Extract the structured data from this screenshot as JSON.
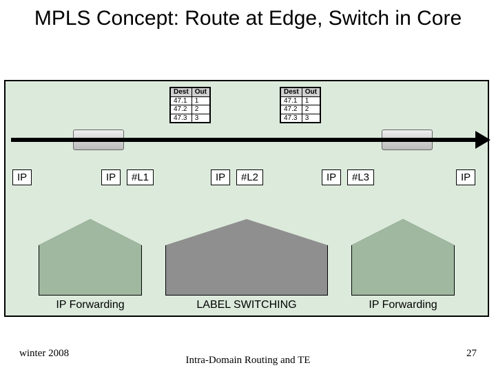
{
  "title": "MPLS Concept: Route at Edge, Switch in Core",
  "tables": {
    "left": {
      "headers": [
        "Dest",
        "Out"
      ],
      "rows": [
        [
          "47.1",
          "1"
        ],
        [
          "47.2",
          "2"
        ],
        [
          "47.3",
          "3"
        ]
      ]
    },
    "right": {
      "headers": [
        "Dest",
        "Out"
      ],
      "rows": [
        [
          "47.1",
          "1"
        ],
        [
          "47.2",
          "2"
        ],
        [
          "47.3",
          "3"
        ]
      ]
    }
  },
  "chips": {
    "ip1": "IP",
    "ip2": "IP",
    "l1": "#L1",
    "ip3": "IP",
    "l2": "#L2",
    "ip4": "IP",
    "l3": "#L3",
    "ip5": "IP"
  },
  "captions": {
    "left": "IP Forwarding",
    "center": "LABEL SWITCHING",
    "right": "IP Forwarding"
  },
  "footer": {
    "left": "winter 2008",
    "center": "Intra-Domain Routing and TE",
    "right": "27"
  },
  "colors": {
    "bg_panel": "#dceadc",
    "building_edge": "#9fb89f",
    "building_core": "#8f8f8f"
  }
}
